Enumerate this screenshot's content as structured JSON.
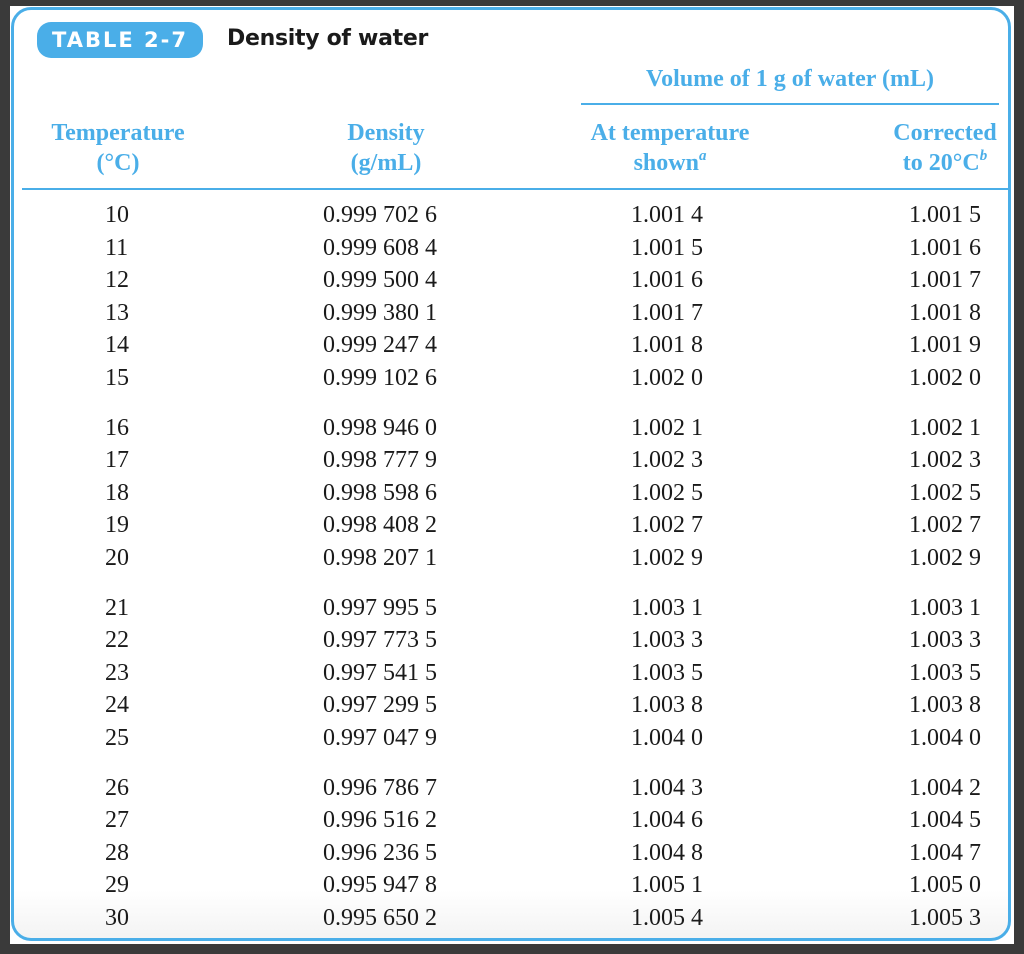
{
  "table": {
    "label": "TABLE 2-7",
    "title": "Density of water",
    "accent_color": "#4aaee8",
    "group_header": "Volume of 1 g of water (mL)",
    "columns": {
      "temperature": {
        "line1": "Temperature",
        "line2": "(°C)"
      },
      "density": {
        "line1": "Density",
        "line2": "(g/mL)"
      },
      "at_temperature": {
        "line1": "At temperature",
        "line2": "shown",
        "footnote": "a"
      },
      "corrected": {
        "line1": "Corrected",
        "line2": "to 20°C",
        "footnote": "b"
      }
    },
    "groups": [
      {
        "rows": [
          {
            "t": "10",
            "d": "0.999 702 6",
            "v": "1.001 4",
            "c": "1.001 5"
          },
          {
            "t": "11",
            "d": "0.999 608 4",
            "v": "1.001 5",
            "c": "1.001 6"
          },
          {
            "t": "12",
            "d": "0.999 500 4",
            "v": "1.001 6",
            "c": "1.001 7"
          },
          {
            "t": "13",
            "d": "0.999 380 1",
            "v": "1.001 7",
            "c": "1.001 8"
          },
          {
            "t": "14",
            "d": "0.999 247 4",
            "v": "1.001 8",
            "c": "1.001 9"
          },
          {
            "t": "15",
            "d": "0.999 102 6",
            "v": "1.002 0",
            "c": "1.002 0"
          }
        ]
      },
      {
        "rows": [
          {
            "t": "16",
            "d": "0.998 946 0",
            "v": "1.002 1",
            "c": "1.002 1"
          },
          {
            "t": "17",
            "d": "0.998 777 9",
            "v": "1.002 3",
            "c": "1.002 3"
          },
          {
            "t": "18",
            "d": "0.998 598 6",
            "v": "1.002 5",
            "c": "1.002 5"
          },
          {
            "t": "19",
            "d": "0.998 408 2",
            "v": "1.002 7",
            "c": "1.002 7"
          },
          {
            "t": "20",
            "d": "0.998 207 1",
            "v": "1.002 9",
            "c": "1.002 9"
          }
        ]
      },
      {
        "rows": [
          {
            "t": "21",
            "d": "0.997 995 5",
            "v": "1.003 1",
            "c": "1.003 1"
          },
          {
            "t": "22",
            "d": "0.997 773 5",
            "v": "1.003 3",
            "c": "1.003 3"
          },
          {
            "t": "23",
            "d": "0.997 541 5",
            "v": "1.003 5",
            "c": "1.003 5"
          },
          {
            "t": "24",
            "d": "0.997 299 5",
            "v": "1.003 8",
            "c": "1.003 8"
          },
          {
            "t": "25",
            "d": "0.997 047 9",
            "v": "1.004 0",
            "c": "1.004 0"
          }
        ]
      },
      {
        "rows": [
          {
            "t": "26",
            "d": "0.996 786 7",
            "v": "1.004 3",
            "c": "1.004 2"
          },
          {
            "t": "27",
            "d": "0.996 516 2",
            "v": "1.004 6",
            "c": "1.004 5"
          },
          {
            "t": "28",
            "d": "0.996 236 5",
            "v": "1.004 8",
            "c": "1.004 7"
          },
          {
            "t": "29",
            "d": "0.995 947 8",
            "v": "1.005 1",
            "c": "1.005 0"
          },
          {
            "t": "30",
            "d": "0.995 650 2",
            "v": "1.005 4",
            "c": "1.005 3"
          }
        ]
      }
    ]
  }
}
